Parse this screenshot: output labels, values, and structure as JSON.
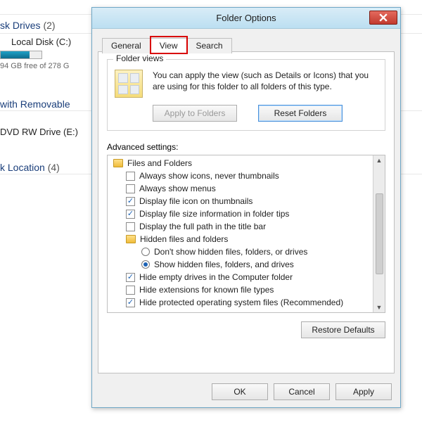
{
  "background": {
    "drives_group": "sk Drives",
    "drives_count": "(2)",
    "local_disk": "Local Disk (C:)",
    "usage_text": "94 GB free of 278 G",
    "usage_pct": 70,
    "removable_group": "with Removable",
    "dvd_drive": "DVD RW Drive (E:)",
    "location_group": "k Location",
    "location_count": "(4)"
  },
  "dialog": {
    "title": "Folder Options",
    "tabs": {
      "general": "General",
      "view": "View",
      "search": "Search"
    },
    "folder_views": {
      "legend": "Folder views",
      "text": "You can apply the view (such as Details or Icons) that you are using for this folder to all folders of this type.",
      "apply_btn": "Apply to Folders",
      "reset_btn": "Reset Folders"
    },
    "advanced_label": "Advanced settings:",
    "tree": [
      {
        "kind": "folder",
        "indent": 0,
        "label": "Files and Folders"
      },
      {
        "kind": "check",
        "indent": 1,
        "checked": false,
        "label": "Always show icons, never thumbnails"
      },
      {
        "kind": "check",
        "indent": 1,
        "checked": false,
        "label": "Always show menus"
      },
      {
        "kind": "check",
        "indent": 1,
        "checked": true,
        "label": "Display file icon on thumbnails"
      },
      {
        "kind": "check",
        "indent": 1,
        "checked": true,
        "label": "Display file size information in folder tips"
      },
      {
        "kind": "check",
        "indent": 1,
        "checked": false,
        "label": "Display the full path in the title bar"
      },
      {
        "kind": "folder",
        "indent": 1,
        "label": "Hidden files and folders"
      },
      {
        "kind": "radio",
        "indent": 2,
        "checked": false,
        "label": "Don't show hidden files, folders, or drives"
      },
      {
        "kind": "radio",
        "indent": 2,
        "checked": true,
        "label": "Show hidden files, folders, and drives"
      },
      {
        "kind": "check",
        "indent": 1,
        "checked": true,
        "label": "Hide empty drives in the Computer folder"
      },
      {
        "kind": "check",
        "indent": 1,
        "checked": false,
        "label": "Hide extensions for known file types"
      },
      {
        "kind": "check",
        "indent": 1,
        "checked": true,
        "label": "Hide protected operating system files (Recommended)"
      }
    ],
    "restore_btn": "Restore Defaults",
    "ok_btn": "OK",
    "cancel_btn": "Cancel",
    "apply_btn": "Apply"
  }
}
